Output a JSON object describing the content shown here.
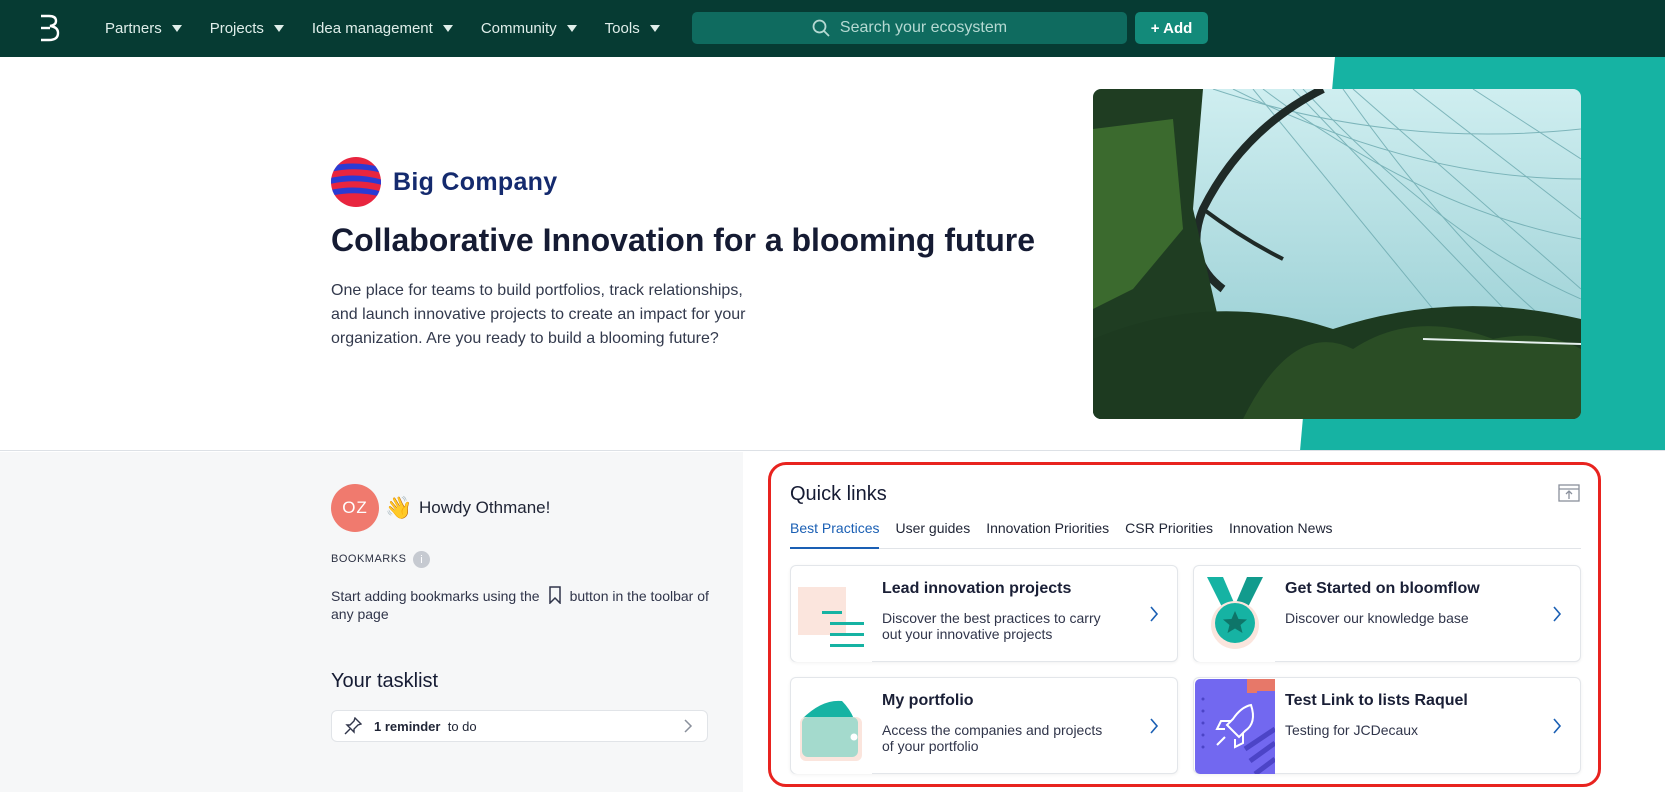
{
  "nav": {
    "items": [
      {
        "label": "Partners"
      },
      {
        "label": "Projects"
      },
      {
        "label": "Idea management"
      },
      {
        "label": "Community"
      },
      {
        "label": "Tools"
      }
    ],
    "search_placeholder": "Search your ecosystem",
    "add_label": "+ Add"
  },
  "hero": {
    "brand_name": "Big Company",
    "title": "Collaborative Innovation for a blooming future",
    "description": "One place for teams to build portfolios, track relationships, and launch innovative projects to create an impact for your organization. Are you ready to build a blooming future?"
  },
  "user": {
    "initials": "OZ",
    "greeting": "Howdy Othmane!",
    "wave_emoji": "👋"
  },
  "bookmarks": {
    "label": "BOOKMARKS",
    "info": "i",
    "text_before": "Start adding bookmarks using the",
    "text_after": "button in the toolbar of any page"
  },
  "tasklist": {
    "title": "Your tasklist",
    "reminder_count": "1 reminder",
    "reminder_suffix": "to do"
  },
  "quick_links": {
    "title": "Quick links",
    "tabs": [
      {
        "label": "Best Practices",
        "active": true
      },
      {
        "label": "User guides"
      },
      {
        "label": "Innovation Priorities"
      },
      {
        "label": "CSR Priorities"
      },
      {
        "label": "Innovation News"
      }
    ],
    "cards": [
      {
        "title": "Lead innovation projects",
        "description": "Discover the best practices to carry out your innovative projects"
      },
      {
        "title": "Get Started on bloomflow",
        "description": "Discover our knowledge base"
      },
      {
        "title": "My portfolio",
        "description": "Access the companies and projects of your portfolio"
      },
      {
        "title": "Test Link to lists Raquel",
        "description": "Testing for JCDecaux"
      }
    ]
  },
  "colors": {
    "topbar": "#063b33",
    "accent_teal": "#16b3a3",
    "active_tab": "#1a5fb4",
    "highlight_border": "#e8231f"
  }
}
